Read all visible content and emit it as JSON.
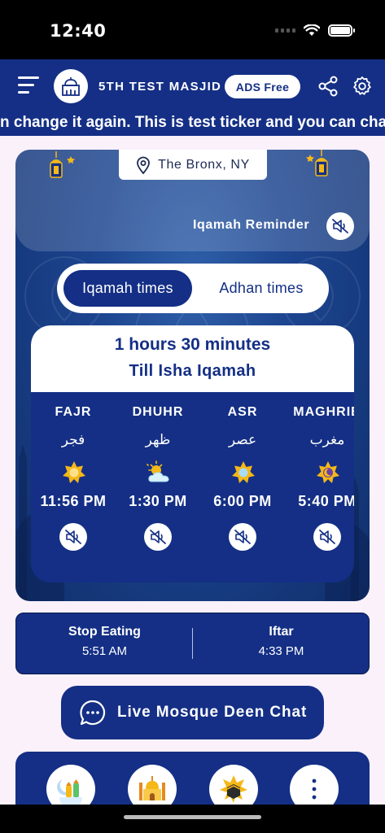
{
  "status_bar": {
    "time": "12:40"
  },
  "header": {
    "masjid_name": "5TH TEST MASJID",
    "ads_label": "ADS Free"
  },
  "ticker": {
    "text": "n change it again.  This is test ticker and you can change it again.  This is test ticker"
  },
  "location": {
    "text": "The Bronx, NY"
  },
  "reminder": {
    "label": "Iqamah Reminder"
  },
  "tabs": {
    "iqamah": "Iqamah times",
    "adhan": "Adhan times",
    "selected": "iqamah"
  },
  "countdown": {
    "time": "1 hours 30 minutes",
    "subtitle": "Till Isha Iqamah"
  },
  "prayers": [
    {
      "name": "FAJR",
      "arabic": "فجر",
      "time": "11:56 PM",
      "icon": "sun-star-icon"
    },
    {
      "name": "DHUHR",
      "arabic": "ظهر",
      "time": "1:30 PM",
      "icon": "sun-cloud-icon"
    },
    {
      "name": "ASR",
      "arabic": "عصر",
      "time": "6:00 PM",
      "icon": "sun-star-icon"
    },
    {
      "name": "MAGHRIB",
      "arabic": "مغرب",
      "time": "5:40 PM",
      "icon": "moon-star-icon"
    }
  ],
  "fasting": {
    "stop_eating_label": "Stop Eating",
    "stop_eating_time": "5:51 AM",
    "iftar_label": "Iftar",
    "iftar_time": "4:33 PM"
  },
  "chat": {
    "label": "Live Mosque Deen Chat"
  },
  "colors": {
    "primary": "#142f85",
    "background": "#faf1fb",
    "accent_gold": "#f5b819"
  }
}
